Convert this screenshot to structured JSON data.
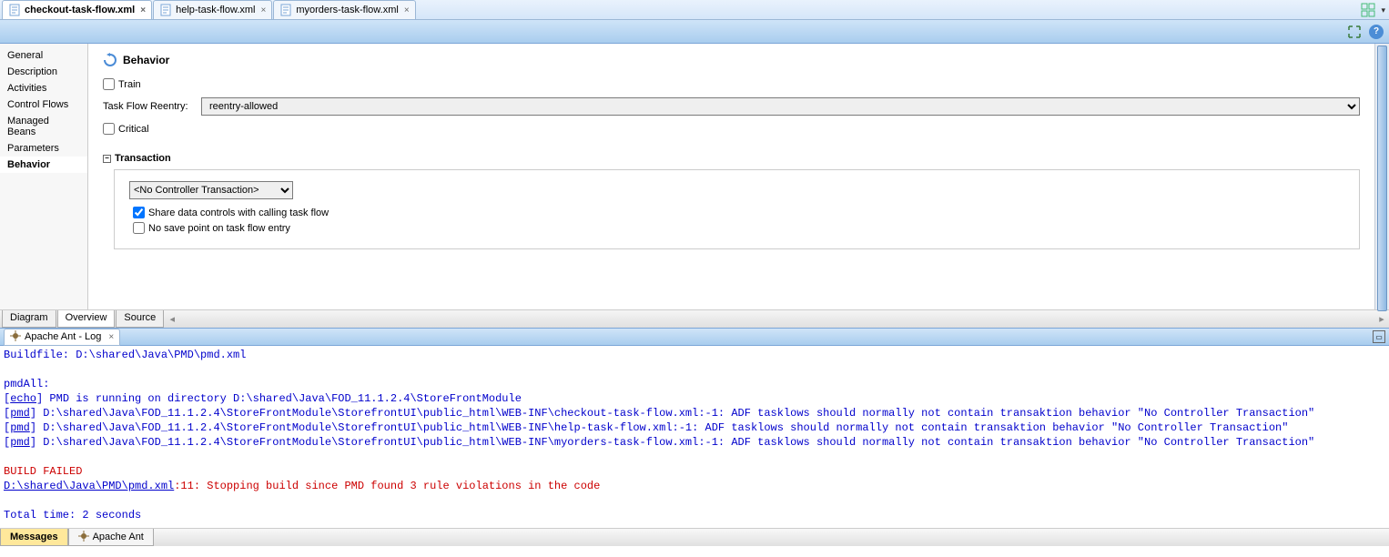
{
  "editor_tabs": [
    {
      "label": "checkout-task-flow.xml",
      "closable": true,
      "active": true
    },
    {
      "label": "help-task-flow.xml",
      "closable": true,
      "active": false
    },
    {
      "label": "myorders-task-flow.xml",
      "closable": true,
      "active": false
    }
  ],
  "side_nav": [
    "General",
    "Description",
    "Activities",
    "Control Flows",
    "Managed Beans",
    "Parameters",
    "Behavior"
  ],
  "side_nav_selected": "Behavior",
  "section": {
    "title": "Behavior",
    "train_label": "Train",
    "train_checked": false,
    "reentry_label": "Task Flow Reentry:",
    "reentry_value": "reentry-allowed",
    "critical_label": "Critical",
    "critical_checked": false
  },
  "transaction": {
    "heading": "Transaction",
    "controller_value": "<No Controller Transaction>",
    "share_label": "Share data controls with calling task flow",
    "share_checked": true,
    "nosave_label": "No save point on task flow entry",
    "nosave_checked": false
  },
  "bottom_tabs": [
    "Diagram",
    "Overview",
    "Source"
  ],
  "bottom_tab_active": "Overview",
  "log_panel": {
    "tab_label": "Apache Ant - Log",
    "lines": [
      {
        "parts": [
          {
            "cls": "blue",
            "text": "Buildfile: D:\\shared\\Java\\PMD\\pmd.xml"
          }
        ]
      },
      {
        "parts": [
          {
            "cls": "blue",
            "text": ""
          }
        ]
      },
      {
        "parts": [
          {
            "cls": "blue",
            "text": "pmdAll:"
          }
        ]
      },
      {
        "parts": [
          {
            "cls": "blue",
            "text": "     ["
          },
          {
            "cls": "link",
            "text": "echo"
          },
          {
            "cls": "blue",
            "text": "] PMD is running on directory D:\\shared\\Java\\FOD_11.1.2.4\\StoreFrontModule"
          }
        ]
      },
      {
        "parts": [
          {
            "cls": "blue",
            "text": "     ["
          },
          {
            "cls": "link",
            "text": "pmd"
          },
          {
            "cls": "blue",
            "text": "] D:\\shared\\Java\\FOD_11.1.2.4\\StoreFrontModule\\StorefrontUI\\public_html\\WEB-INF\\checkout-task-flow.xml:-1:      ADF tasklows should normally not contain transaktion behavior \"No Controller Transaction\""
          }
        ]
      },
      {
        "parts": [
          {
            "cls": "blue",
            "text": "     ["
          },
          {
            "cls": "link",
            "text": "pmd"
          },
          {
            "cls": "blue",
            "text": "] D:\\shared\\Java\\FOD_11.1.2.4\\StoreFrontModule\\StorefrontUI\\public_html\\WEB-INF\\help-task-flow.xml:-1: ADF tasklows should normally not contain transaktion behavior \"No Controller Transaction\""
          }
        ]
      },
      {
        "parts": [
          {
            "cls": "blue",
            "text": "     ["
          },
          {
            "cls": "link",
            "text": "pmd"
          },
          {
            "cls": "blue",
            "text": "] D:\\shared\\Java\\FOD_11.1.2.4\\StoreFrontModule\\StorefrontUI\\public_html\\WEB-INF\\myorders-task-flow.xml:-1:      ADF tasklows should normally not contain transaktion behavior \"No Controller Transaction\""
          }
        ]
      },
      {
        "parts": [
          {
            "cls": "blue",
            "text": ""
          }
        ]
      },
      {
        "parts": [
          {
            "cls": "red",
            "text": "BUILD FAILED"
          }
        ]
      },
      {
        "parts": [
          {
            "cls": "link",
            "text": "D:\\shared\\Java\\PMD\\pmd.xml"
          },
          {
            "cls": "red",
            "text": ":11: Stopping build since PMD found 3 rule violations in the code"
          }
        ]
      },
      {
        "parts": [
          {
            "cls": "red",
            "text": ""
          }
        ]
      },
      {
        "parts": [
          {
            "cls": "blue",
            "text": "Total time: 2 seconds"
          }
        ]
      }
    ]
  },
  "status_tabs": {
    "messages": "Messages",
    "ant": "Apache Ant"
  },
  "dropdown_icon": "▾"
}
